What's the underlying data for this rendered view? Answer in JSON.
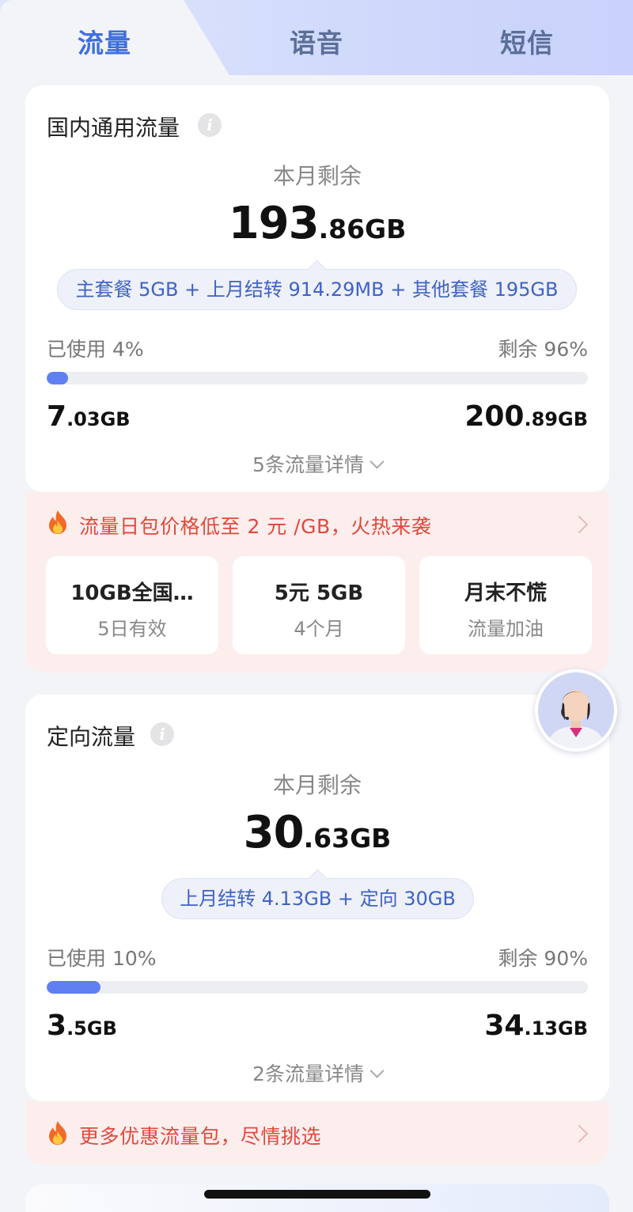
{
  "tabs": [
    {
      "label": "流量",
      "active": true
    },
    {
      "label": "语音",
      "active": false
    },
    {
      "label": "短信",
      "active": false
    }
  ],
  "domestic": {
    "title": "国内通用流量",
    "remain_label": "本月剩余",
    "remain_int": "193",
    "remain_dec": ".86GB",
    "breakdown": "主套餐 5GB + 上月结转 914.29MB + 其他套餐 195GB",
    "used_label": "已使用 4%",
    "left_label": "剩余 96%",
    "used_fraction": 0.04,
    "used_int": "7",
    "used_dec": ".03GB",
    "total_int": "200",
    "total_dec": ".89GB",
    "details": "5条流量详情"
  },
  "promo1": {
    "text": "流量日包价格低至 2 元 /GB，火热来袭",
    "packages": [
      {
        "title": "10GB全国…",
        "sub": "5日有效"
      },
      {
        "title": "5元 5GB",
        "sub": "4个月"
      },
      {
        "title": "月末不慌",
        "sub": "流量加油"
      }
    ]
  },
  "directed": {
    "title": "定向流量",
    "remain_label": "本月剩余",
    "remain_int": "30",
    "remain_dec": ".63GB",
    "breakdown": "上月结转 4.13GB + 定向 30GB",
    "used_label": "已使用 10%",
    "left_label": "剩余 90%",
    "used_fraction": 0.1,
    "used_int": "3",
    "used_dec": ".5GB",
    "total_int": "34",
    "total_dec": ".13GB",
    "details": "2条流量详情"
  },
  "promo2": {
    "text": "更多优惠流量包，尽情挑选"
  },
  "colors": {
    "accent": "#3d6fe0",
    "bar_fill": "#5f7ff2",
    "promo_text": "#e0493c",
    "promo_bg": "#fdeeee"
  }
}
